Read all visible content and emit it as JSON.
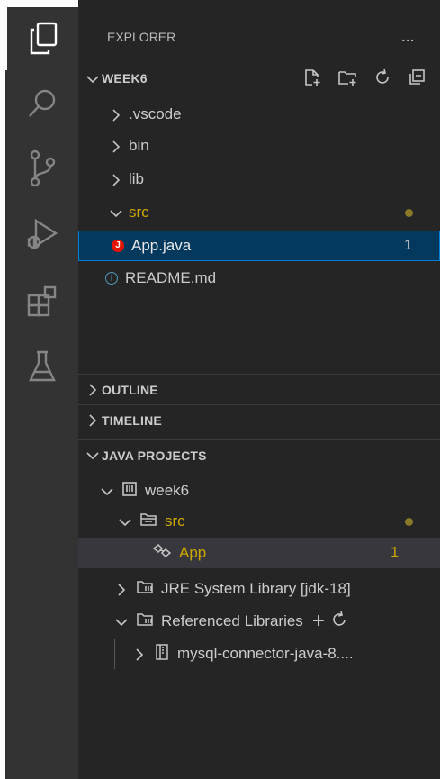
{
  "explorer": {
    "title": "EXPLORER",
    "more_label": "...",
    "workspace": "WEEK6",
    "items": [
      {
        "label": ".vscode"
      },
      {
        "label": "bin"
      },
      {
        "label": "lib"
      },
      {
        "label": "src"
      },
      {
        "label": "App.java",
        "badge": "1"
      },
      {
        "label": "README.md"
      }
    ]
  },
  "sections": {
    "outline": "OUTLINE",
    "timeline": "TIMELINE",
    "java_projects": "JAVA PROJECTS"
  },
  "java_projects": {
    "project": "week6",
    "src": "src",
    "app": "App",
    "app_badge": "1",
    "jre": "JRE System Library [jdk-18]",
    "ref_libs": "Referenced Libraries",
    "add_label": "+",
    "jar": "mysql-connector-java-8...."
  },
  "colors": {
    "activity_bar": "#333333",
    "sidebar": "#252526",
    "selection": "#04395e",
    "warning": "#cca700",
    "error": "#e51400"
  }
}
